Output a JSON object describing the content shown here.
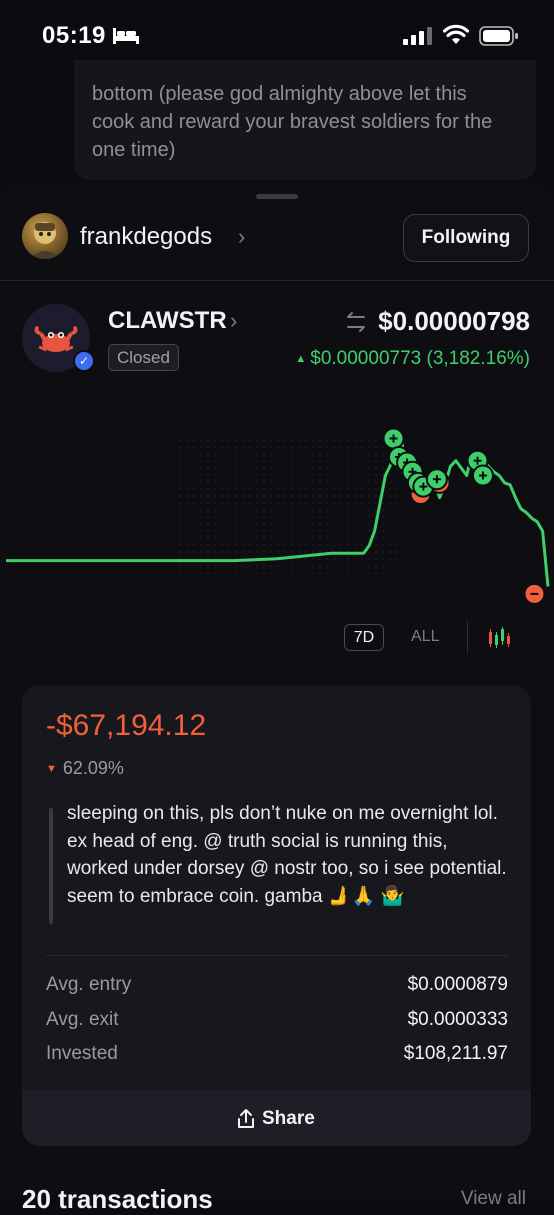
{
  "status_bar": {
    "time": "05:19"
  },
  "previous_post": {
    "text": "bottom (please god almighty above let this cook and reward your bravest soldiers for the one time)"
  },
  "user": {
    "name": "frankdegods",
    "follow_label": "Following"
  },
  "token": {
    "ticker": "CLAWSTR",
    "status": "Closed",
    "price": "$0.00000798",
    "change": "$0.00000773 (3,182.16%)",
    "colors": {
      "up": "#3ecf6a",
      "down": "#f0603a",
      "line": "#3ecf6a"
    }
  },
  "chart_data": {
    "type": "line",
    "title": "",
    "xlabel": "",
    "ylabel": "",
    "x": [
      0,
      8,
      16,
      22,
      24,
      26,
      30,
      36,
      42,
      50,
      60,
      66,
      67,
      68,
      70,
      71,
      72,
      73,
      73.5,
      74,
      75,
      76,
      77,
      78,
      79,
      80,
      81,
      82,
      83,
      84,
      85,
      86,
      87,
      88,
      89,
      90,
      91,
      92,
      93,
      94,
      95,
      96,
      97,
      98,
      99,
      100
    ],
    "values": [
      0.24,
      0.24,
      0.24,
      0.24,
      0.24,
      0.24,
      0.24,
      0.24,
      0.24,
      0.25,
      0.28,
      0.28,
      0.32,
      0.4,
      0.7,
      0.76,
      0.92,
      0.88,
      0.8,
      0.74,
      0.6,
      0.7,
      0.63,
      0.6,
      0.67,
      0.58,
      0.65,
      0.75,
      0.78,
      0.74,
      0.7,
      0.82,
      0.76,
      0.78,
      0.75,
      0.72,
      0.7,
      0.66,
      0.65,
      0.58,
      0.52,
      0.5,
      0.47,
      0.45,
      0.4,
      0.1
    ],
    "y_range": [
      0,
      1
    ],
    "grid": false,
    "buy_markers": [
      [
        71.5,
        0.9
      ],
      [
        72.5,
        0.8
      ],
      [
        74,
        0.77
      ],
      [
        75,
        0.72
      ],
      [
        76,
        0.66
      ],
      [
        77,
        0.64
      ],
      [
        79.5,
        0.68
      ],
      [
        87,
        0.78
      ],
      [
        88,
        0.7
      ]
    ],
    "sell_markers": [
      [
        76.5,
        0.6
      ],
      [
        80,
        0.66
      ],
      [
        97.5,
        0.06
      ]
    ],
    "timeframes": [
      "7D",
      "ALL"
    ],
    "selected_timeframe": "7D"
  },
  "position": {
    "pnl": "-$67,194.12",
    "pnl_pct": "62.09%",
    "note": "sleeping on this, pls don’t nuke on me overnight lol. ex head of eng. @ truth social is running this, worked under dorsey @ nostr too, so i see potential. seem to embrace coin. gamba 🫸🙏 🤷‍♂️",
    "stats": [
      {
        "label": "Avg. entry",
        "value": "$0.0000879"
      },
      {
        "label": "Avg. exit",
        "value": "$0.0000333"
      },
      {
        "label": "Invested",
        "value": "$108,211.97"
      }
    ],
    "share_label": "Share"
  },
  "transactions": {
    "title": "20 transactions",
    "view_all": "View all"
  }
}
